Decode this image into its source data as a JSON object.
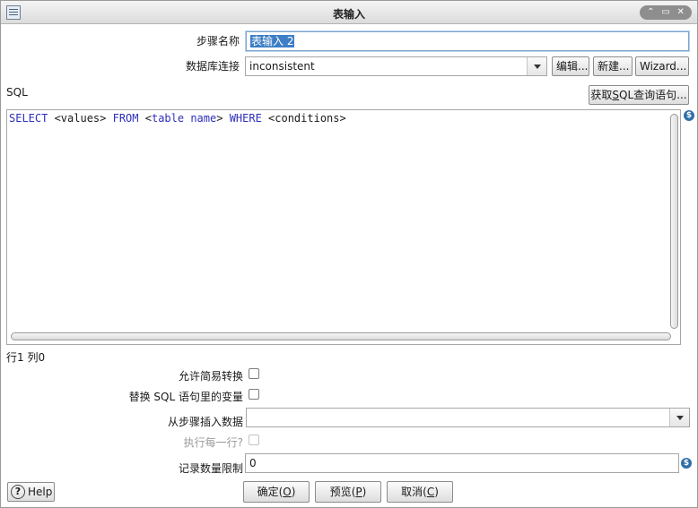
{
  "window": {
    "title": "表输入",
    "controls": [
      "⌃",
      "✕"
    ]
  },
  "form": {
    "step_name_label": "步骤名称",
    "step_name_value": "表输入 2",
    "db_connection_label": "数据库连接",
    "db_connection_value": "inconsistent",
    "edit_button": "编辑...",
    "new_button": "新建...",
    "wizard_button": "Wizard...",
    "sql_label": "SQL",
    "get_sql_button_pre": "获取",
    "get_sql_button_mnemonic": "S",
    "get_sql_button_post": "QL查询语句...",
    "sql_text": {
      "select": "SELECT",
      "values": " <values> ",
      "from": "FROM",
      "table_open": " <",
      "table_kw1": "table",
      "table_space": " ",
      "table_kw2": "name",
      "table_close": "> ",
      "where": "WHERE",
      "conditions": " <conditions>"
    },
    "cursor_position": "行1 列0",
    "allow_lazy_conversion_label": "允许简易转换",
    "replace_variables_label": "替换 SQL 语句里的变量",
    "insert_from_step_label": "从步骤插入数据",
    "insert_from_step_value": "",
    "execute_each_row_label": "执行每一行?",
    "limit_label": "记录数量限制",
    "limit_value": "0"
  },
  "footer": {
    "help_label": "Help",
    "ok_label": "确定",
    "ok_mnemonic": "O",
    "preview_label": "预览",
    "preview_mnemonic": "P",
    "cancel_label": "取消",
    "cancel_mnemonic": "C"
  },
  "icons": {
    "variable_icon": "$",
    "help_icon": "?"
  },
  "colors": {
    "selection": "#3d7ec6",
    "sql_keyword": "#2e2ebd"
  }
}
